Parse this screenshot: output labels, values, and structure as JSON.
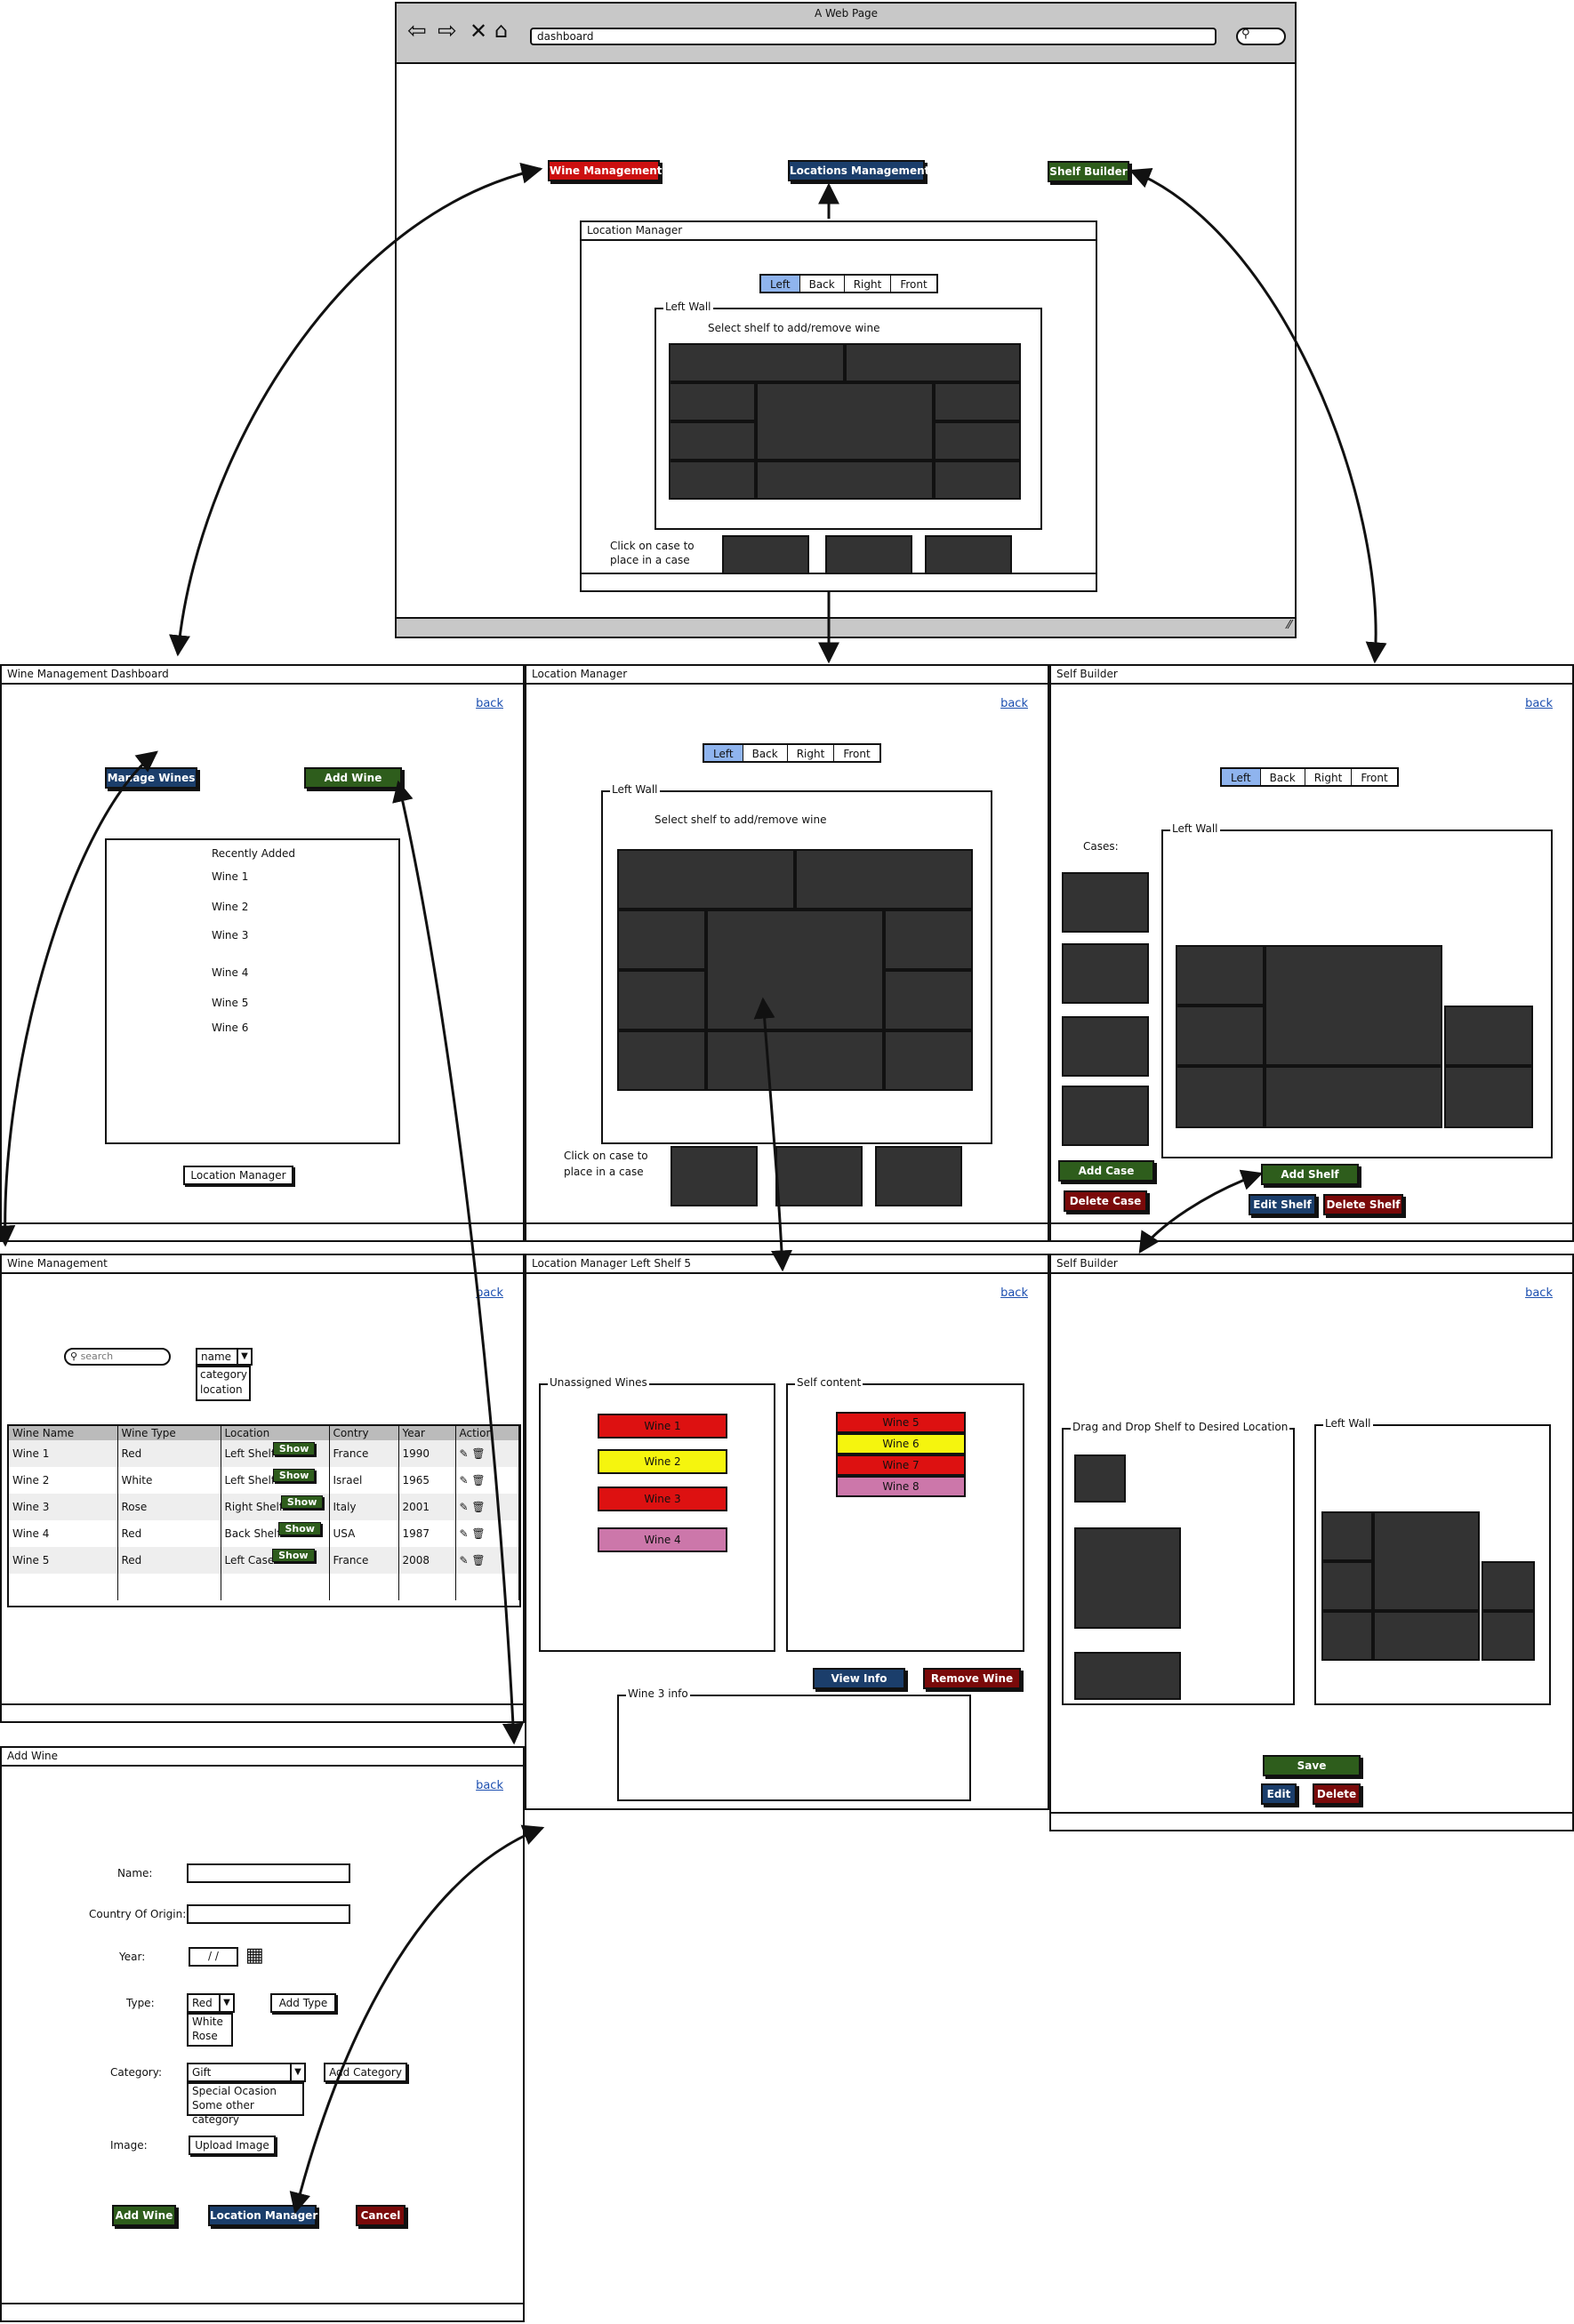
{
  "browser": {
    "title": "A Web Page",
    "address": "dashboard"
  },
  "nav": {
    "wine_management": "Wine Management",
    "locations_management": "Locations Management",
    "shelf_builder": "Shelf Builder"
  },
  "tabs": [
    "Left",
    "Back",
    "Right",
    "Front"
  ],
  "location_manager": {
    "title": "Location Manager",
    "group": "Left Wall",
    "instruction": "Select shelf to add/remove wine",
    "case_hint_1": "Click on case to",
    "case_hint_2": "place in a case",
    "back": "back"
  },
  "wine_dashboard": {
    "title": "Wine Management Dashboard",
    "back": "back",
    "manage_wines": "Manage Wines",
    "add_wine": "Add Wine",
    "recent_title": "Recently Added",
    "recent": [
      "Wine 1",
      "Wine 2",
      "Wine 3",
      "Wine 4",
      "Wine 5",
      "Wine 6"
    ],
    "location_manager_button": "Location Manager"
  },
  "shelf_builder_1": {
    "title": "Self Builder",
    "back": "back",
    "group": "Left Wall",
    "cases": "Cases:",
    "add_case": "Add Case",
    "delete_case": "Delete Case",
    "add_shelf": "Add Shelf",
    "edit_shelf": "Edit Shelf",
    "delete_shelf": "Delete Shelf"
  },
  "wine_management": {
    "title": "Wine Management",
    "back": "back",
    "search_placeholder": "search",
    "sort_selected": "name",
    "sort_options": [
      "category",
      "location"
    ],
    "columns": [
      "Wine Name",
      "Wine Type",
      "Location",
      "Contry",
      "Year",
      "Action"
    ],
    "show": "Show",
    "rows": [
      [
        "Wine 1",
        "Red",
        "Left Shelf",
        "France",
        "1990"
      ],
      [
        "Wine 2",
        "White",
        "Left Shelf",
        "Israel",
        "1965"
      ],
      [
        "Wine 3",
        "Rose",
        "Right Shelf",
        "Italy",
        "2001"
      ],
      [
        "Wine 4",
        "Red",
        "Back Shelf",
        "USA",
        "1987"
      ],
      [
        "Wine 5",
        "Red",
        "Left Case",
        "France",
        "2008"
      ]
    ]
  },
  "shelf5": {
    "title": "Location Manager Left Shelf 5",
    "back": "back",
    "unassigned_title": "Unassigned Wines",
    "content_title": "Self content",
    "unassigned": [
      {
        "name": "Wine 1",
        "color": "#dd1111"
      },
      {
        "name": "Wine 2",
        "color": "#f5f50e"
      },
      {
        "name": "Wine 3",
        "color": "#dd1111"
      },
      {
        "name": "Wine 4",
        "color": "#cc77aa"
      }
    ],
    "content": [
      {
        "name": "Wine 5",
        "color": "#dd1111"
      },
      {
        "name": "Wine 6",
        "color": "#f5f50e"
      },
      {
        "name": "Wine 7",
        "color": "#dd1111"
      },
      {
        "name": "Wine 8",
        "color": "#cc77aa"
      }
    ],
    "view_info": "View Info",
    "remove_wine": "Remove Wine",
    "info_title": "Wine 3 info"
  },
  "shelf_builder_2": {
    "title": "Self Builder",
    "back": "back",
    "drag_title": "Drag and Drop Shelf to Desired Location",
    "group": "Left Wall",
    "save": "Save",
    "edit": "Edit",
    "delete": "Delete"
  },
  "add_wine": {
    "title": "Add Wine",
    "back": "back",
    "name_label": "Name:",
    "country_label": "Country Of Origin:",
    "year_label": "Year:",
    "year_value": "/ /",
    "type_label": "Type:",
    "type_selected": "Red",
    "type_options": [
      "White",
      "Rose"
    ],
    "add_type": "Add Type",
    "category_label": "Category:",
    "category_selected": "Gift",
    "category_options": [
      "Special Ocasion",
      "Some other category"
    ],
    "add_category": "Add Category",
    "image_label": "Image:",
    "upload": "Upload Image",
    "add_wine": "Add Wine",
    "location_manager": "Location Manager",
    "cancel": "Cancel"
  }
}
